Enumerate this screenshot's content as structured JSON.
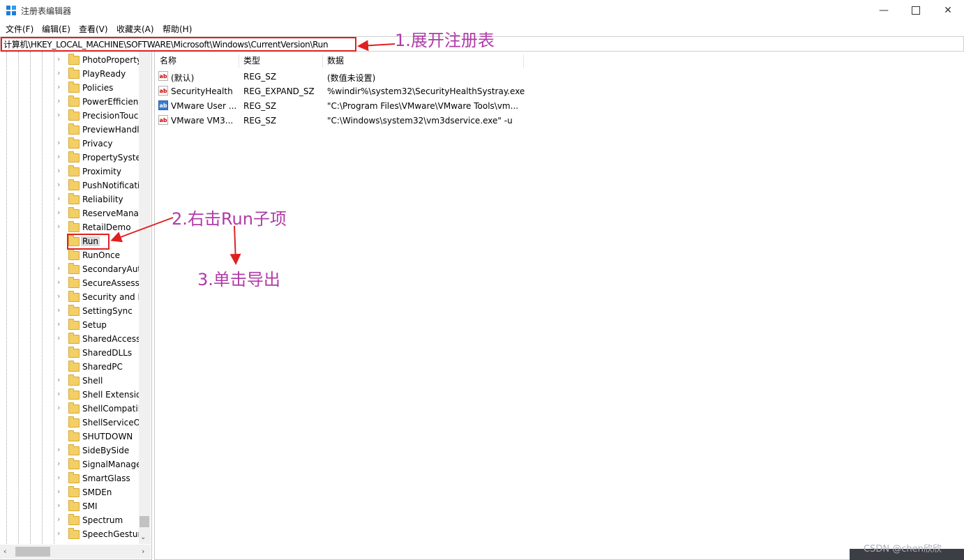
{
  "window": {
    "title": "注册表编辑器"
  },
  "menu": [
    "文件(F)",
    "编辑(E)",
    "查看(V)",
    "收藏夹(A)",
    "帮助(H)"
  ],
  "address": {
    "path": "计算机\\HKEY_LOCAL_MACHINE\\SOFTWARE\\Microsoft\\Windows\\CurrentVersion\\Run"
  },
  "tree": {
    "items": [
      {
        "label": "PhotoProperty",
        "expandable": true
      },
      {
        "label": "PlayReady",
        "expandable": true
      },
      {
        "label": "Policies",
        "expandable": true
      },
      {
        "label": "PowerEfficienc",
        "expandable": true
      },
      {
        "label": "PrecisionTouc",
        "expandable": true
      },
      {
        "label": "PreviewHandle",
        "expandable": false
      },
      {
        "label": "Privacy",
        "expandable": true
      },
      {
        "label": "PropertySyste",
        "expandable": true
      },
      {
        "label": "Proximity",
        "expandable": true
      },
      {
        "label": "PushNotificati",
        "expandable": true
      },
      {
        "label": "Reliability",
        "expandable": true
      },
      {
        "label": "ReserveManag",
        "expandable": true
      },
      {
        "label": "RetailDemo",
        "expandable": true
      },
      {
        "label": "Run",
        "expandable": false,
        "selected": true
      },
      {
        "label": "RunOnce",
        "expandable": false
      },
      {
        "label": "SecondaryAut",
        "expandable": true
      },
      {
        "label": "SecureAssessr",
        "expandable": true
      },
      {
        "label": "Security and M",
        "expandable": true
      },
      {
        "label": "SettingSync",
        "expandable": true
      },
      {
        "label": "Setup",
        "expandable": true
      },
      {
        "label": "SharedAccess",
        "expandable": true
      },
      {
        "label": "SharedDLLs",
        "expandable": false
      },
      {
        "label": "SharedPC",
        "expandable": false
      },
      {
        "label": "Shell",
        "expandable": true
      },
      {
        "label": "Shell Extensio",
        "expandable": true
      },
      {
        "label": "ShellCompatib",
        "expandable": true
      },
      {
        "label": "ShellServiceOl",
        "expandable": false
      },
      {
        "label": "SHUTDOWN",
        "expandable": false
      },
      {
        "label": "SideBySide",
        "expandable": true
      },
      {
        "label": "SignalManage",
        "expandable": true
      },
      {
        "label": "SmartGlass",
        "expandable": true
      },
      {
        "label": "SMDEn",
        "expandable": true
      },
      {
        "label": "SMI",
        "expandable": true
      },
      {
        "label": "Spectrum",
        "expandable": true
      },
      {
        "label": "SpeechGestur",
        "expandable": true
      }
    ]
  },
  "list": {
    "headers": [
      "名称",
      "类型",
      "数据"
    ],
    "rows": [
      {
        "icon": "string-value-icon",
        "name": "(默认)",
        "type": "REG_SZ",
        "data": "(数值未设置)"
      },
      {
        "icon": "string-value-icon",
        "name": "SecurityHealth",
        "type": "REG_EXPAND_SZ",
        "data": "%windir%\\system32\\SecurityHealthSystray.exe"
      },
      {
        "icon": "string-value-icon-blue",
        "name": "VMware User ...",
        "type": "REG_SZ",
        "data": "\"C:\\Program Files\\VMware\\VMware Tools\\vm..."
      },
      {
        "icon": "string-value-icon",
        "name": "VMware VM3...",
        "type": "REG_SZ",
        "data": "\"C:\\Windows\\system32\\vm3dservice.exe\" -u"
      }
    ]
  },
  "annotations": {
    "step1": "1.展开注册表",
    "step2": "2.右击Run子项",
    "step3": "3.单击导出",
    "color": "#b03aa8",
    "arrow_color": "#e02020"
  },
  "watermark": "CSDN @chen欣欣"
}
